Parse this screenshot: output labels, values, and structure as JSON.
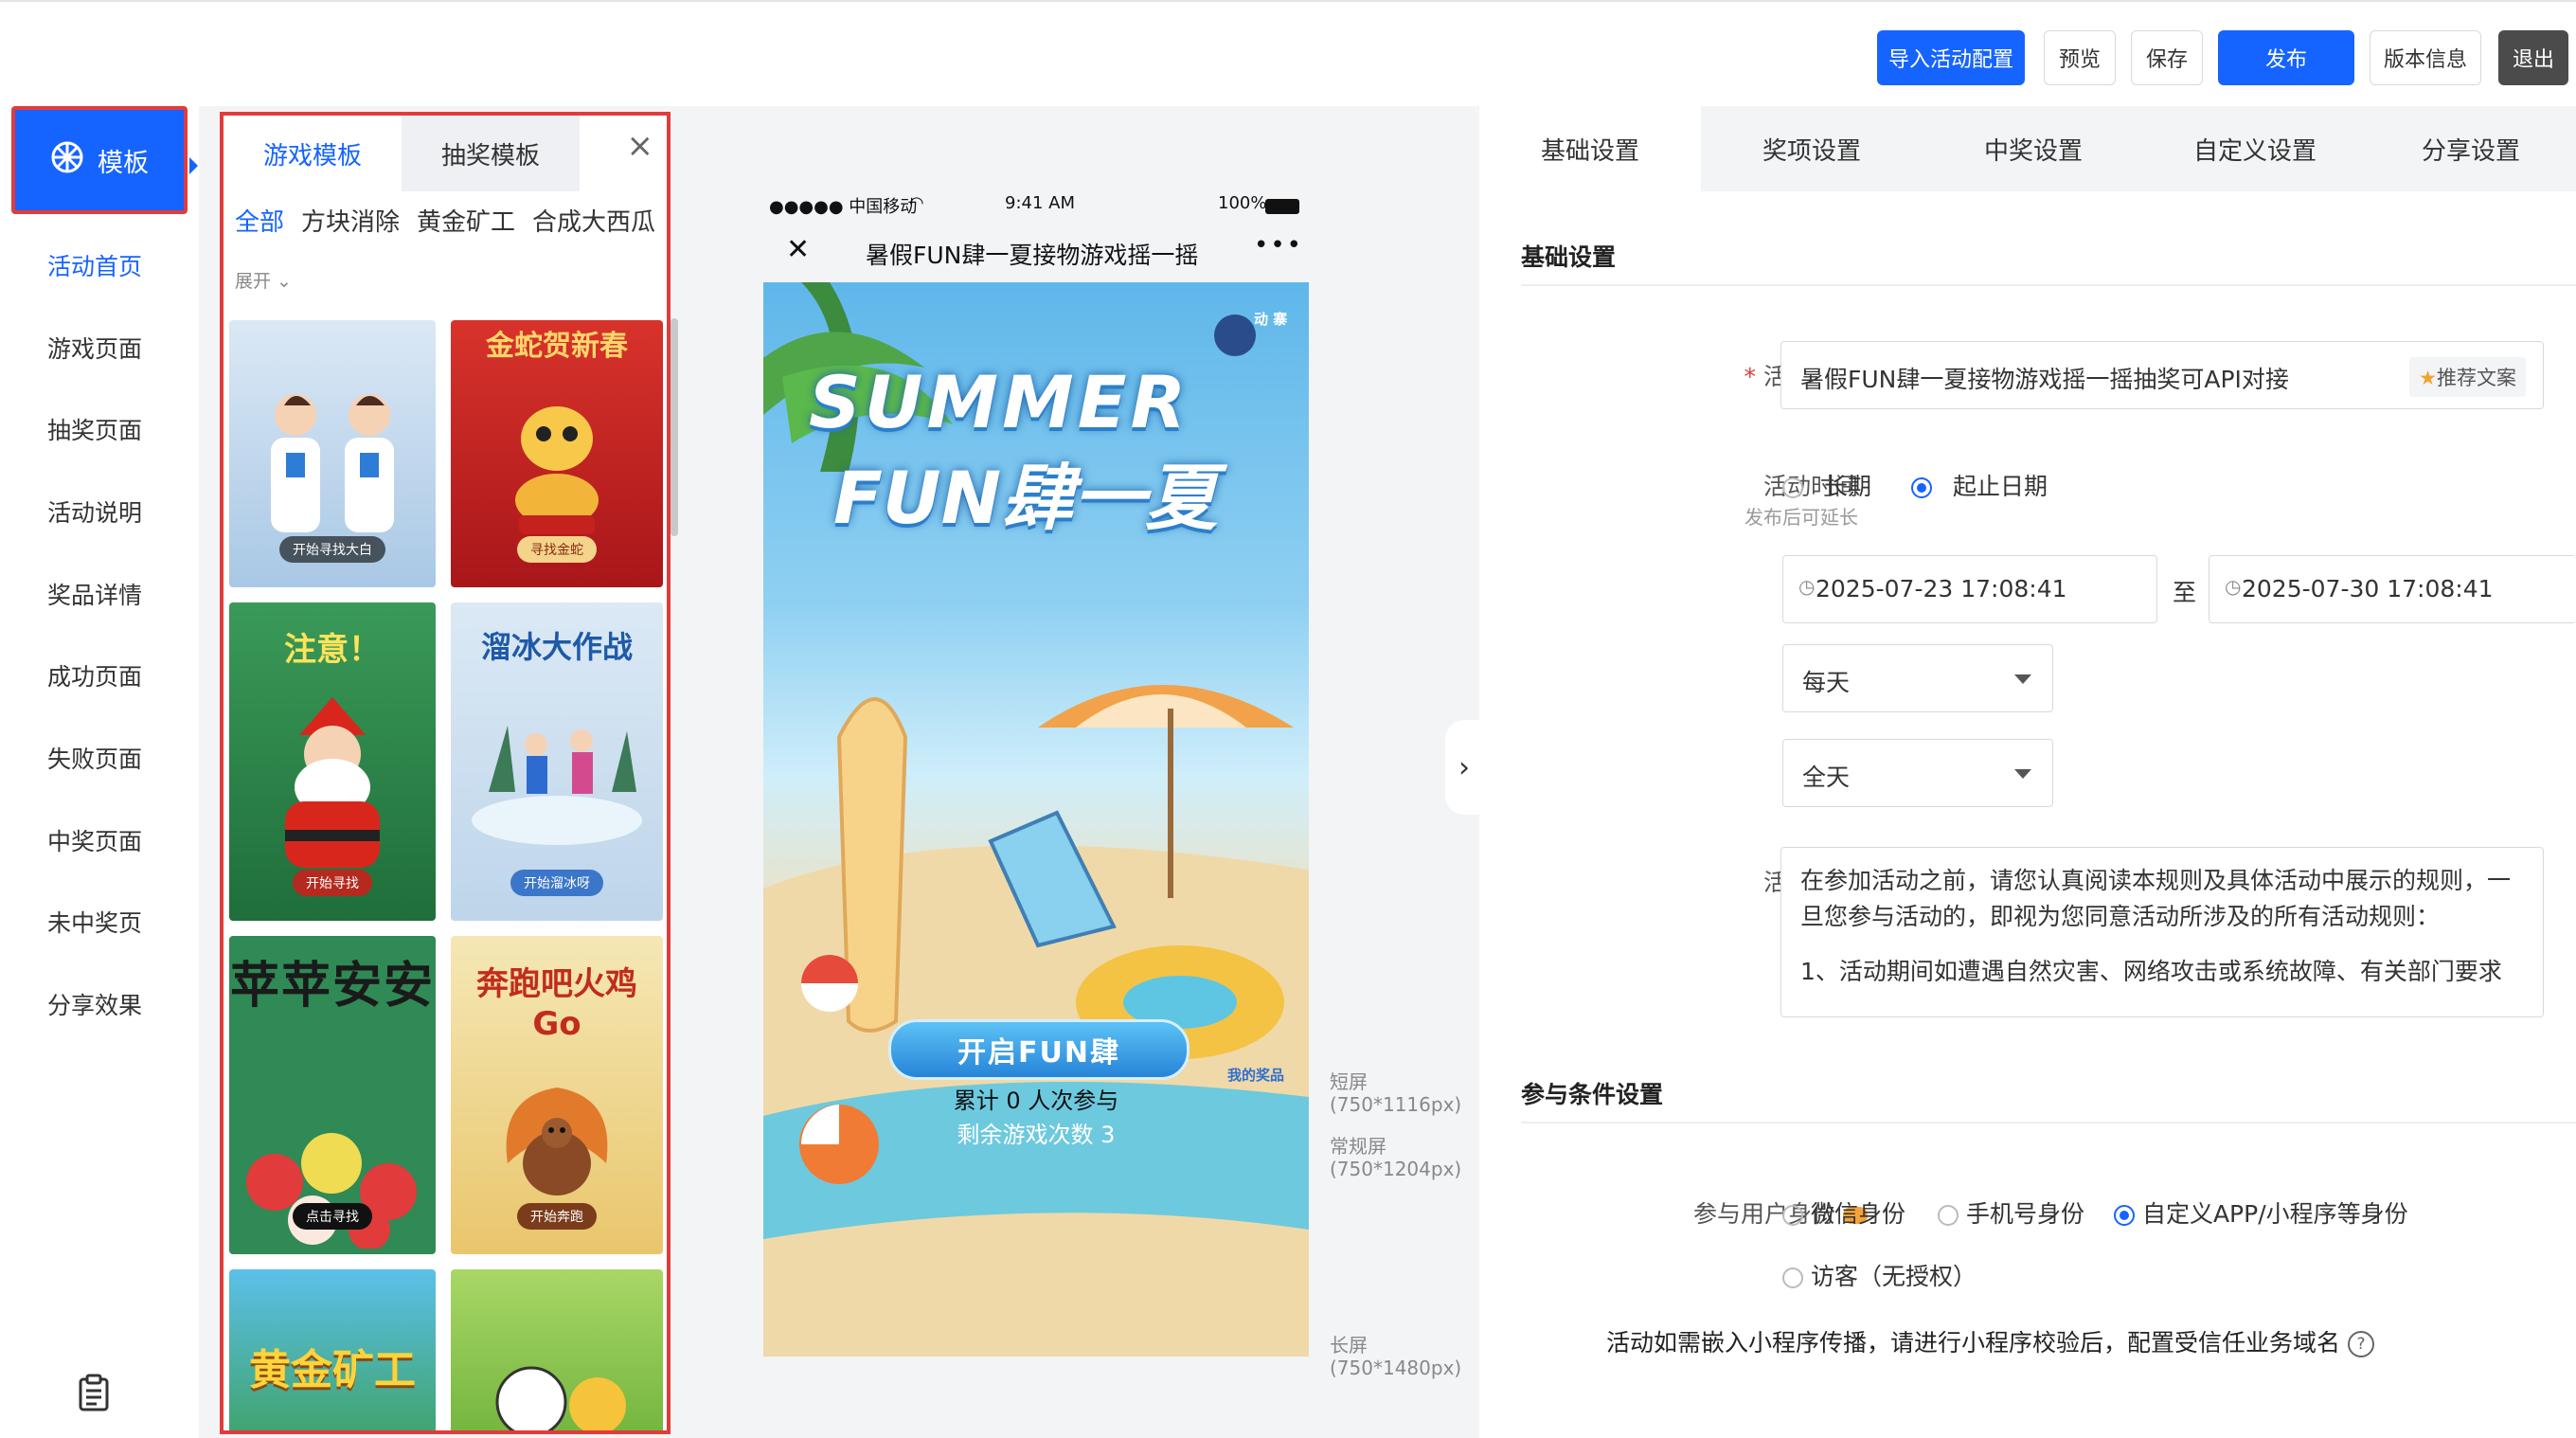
{
  "toolbar": {
    "import_label": "导入活动配置",
    "preview_label": "预览",
    "save_label": "保存",
    "publish_label": "发布",
    "version_label": "版本信息",
    "exit_label": "退出"
  },
  "sidebar": {
    "active_label": "模板",
    "items": [
      "活动首页",
      "游戏页面",
      "抽奖页面",
      "活动说明",
      "奖品详情",
      "成功页面",
      "失败页面",
      "中奖页面",
      "未中奖页",
      "分享效果"
    ]
  },
  "templates": {
    "tab_game": "游戏模板",
    "tab_lottery": "抽奖模板",
    "close": "×",
    "chips": [
      "全部",
      "方块消除",
      "黄金矿工",
      "合成大西瓜"
    ],
    "expand": "展开",
    "cards": [
      {
        "title": "",
        "button": "开始寻找大白",
        "color": "#c9ddf0"
      },
      {
        "title": "金蛇贺新春",
        "button": "寻找金蛇",
        "color": "#c9261f"
      },
      {
        "title": "注意！",
        "button": "开始寻找",
        "color": "#2f8a4a"
      },
      {
        "title": "溜冰大作战",
        "button": "开始溜冰呀",
        "color": "#cfe2f2"
      },
      {
        "title": "苹苹安安",
        "button": "点击寻找",
        "color": "#2f8a55"
      },
      {
        "title": "奔跑吧火鸡Go",
        "button": "开始奔跑",
        "color": "#f2d37a"
      },
      {
        "title": "黄金矿工",
        "button": "",
        "color": "#4fb6e4"
      },
      {
        "title": "",
        "button": "",
        "color": "#8cc94a"
      }
    ]
  },
  "phone": {
    "carrier": "●●●●● 中国移动",
    "time": "9:41 AM",
    "battery": "100%",
    "title": "暑假FUN肆一夏接物游戏摇一摇",
    "more": "•••",
    "close": "✕",
    "hero_line1": "SUMMER",
    "hero_line2": "FUN肆一夏",
    "badge": "动 寨",
    "start_button": "开启FUN肆",
    "participants": "累计 0 人次参与",
    "remaining": "剩余游戏次数 3",
    "my_prize": "我的奖品"
  },
  "screen_labels": {
    "short": "短屏",
    "short_size": "(750*1116px)",
    "normal": "常规屏",
    "normal_size": "(750*1204px)",
    "long": "长屏",
    "long_size": "(750*1480px)"
  },
  "settings": {
    "tabs": [
      "基础设置",
      "奖项设置",
      "中奖设置",
      "自定义设置",
      "分享设置"
    ],
    "section_basic": "基础设置",
    "name_label": "活动名称",
    "required_mark": "*",
    "name_value": "暑假FUN肆一夏接物游戏摇一摇抽奖可API对接",
    "recommend_label": "推荐文案",
    "time_label": "活动时间",
    "time_hint": "发布后可延长",
    "radio_long": "长期",
    "radio_range": "起止日期",
    "start_date": "2025-07-23 17:08:41",
    "to_label": "至",
    "end_date": "2025-07-30 17:08:41",
    "freq_select": "每天",
    "day_select": "全天",
    "desc_label": "活动说明",
    "desc_text_1": "在参加活动之前，请您认真阅读本规则及具体活动中展示的规则，一旦您参与活动的，即视为您同意活动所涉及的所有活动规则：",
    "desc_text_2": "1、活动期间如遭遇自然灾害、网络攻击或系统故障、有关部门要求",
    "section_cond": "参与条件设置",
    "identity_label": "参与用户身份",
    "identity_options": [
      "微信身份",
      "手机号身份",
      "自定义APP/小程序等身份",
      "访客（无授权）"
    ],
    "miniprogram_note": "活动如需嵌入小程序传播，请进行小程序校验后，配置受信任业务域名"
  },
  "colors": {
    "accent": "#1664ff",
    "highlight": "#e23b3b"
  }
}
